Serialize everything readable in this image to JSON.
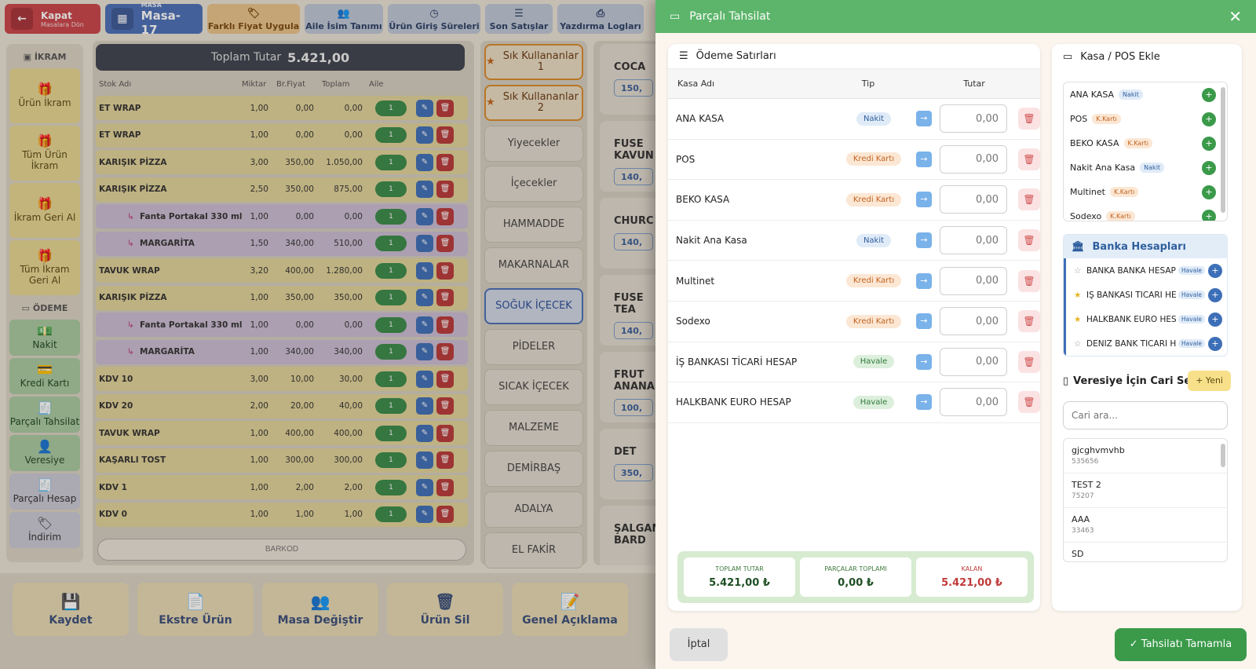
{
  "topbar": {
    "kapat": {
      "label": "Kapat",
      "sub": "Masalara Dön"
    },
    "masa": {
      "label": "MASA",
      "value": "Masa-17"
    },
    "buttons": [
      "Farklı Fiyat Uygula",
      "Aile İsim Tanımı",
      "Ürün Giriş Süreleri",
      "Son Satışlar",
      "Yazdırma Logları"
    ]
  },
  "left": {
    "ikram_header": "İKRAM",
    "ikram_items": [
      "Ürün İkram",
      "Tüm Ürün İkram",
      "İkram Geri Al",
      "Tüm İkram Geri Al"
    ],
    "odeme_header": "ÖDEME",
    "odeme_items": [
      "Nakit",
      "Kredi Kartı",
      "Parçalı Tahsilat",
      "Veresiye",
      "Parçalı Hesap",
      "İndirim"
    ]
  },
  "cart": {
    "total_label": "Toplam Tutar",
    "total_value": "5.421,00",
    "headers": [
      "Stok Adı",
      "Miktar",
      "Br.Fiyat",
      "Toplam",
      "Aile"
    ],
    "rows": [
      {
        "name": "ET WRAP",
        "qty": "1,00",
        "price": "0,00",
        "total": "0,00",
        "aile": "1",
        "sub": false
      },
      {
        "name": "ET WRAP",
        "qty": "1,00",
        "price": "0,00",
        "total": "0,00",
        "aile": "1",
        "sub": false
      },
      {
        "name": "KARIŞIK PİZZA",
        "qty": "3,00",
        "price": "350,00",
        "total": "1.050,00",
        "aile": "1",
        "sub": false
      },
      {
        "name": "KARIŞIK PİZZA",
        "qty": "2,50",
        "price": "350,00",
        "total": "875,00",
        "aile": "1",
        "sub": false
      },
      {
        "name": "Fanta Portakal 330 ml",
        "qty": "1,00",
        "price": "0,00",
        "total": "0,00",
        "aile": "1",
        "sub": true
      },
      {
        "name": "MARGARİTA",
        "qty": "1,50",
        "price": "340,00",
        "total": "510,00",
        "aile": "1",
        "sub": true
      },
      {
        "name": "TAVUK WRAP",
        "qty": "3,20",
        "price": "400,00",
        "total": "1.280,00",
        "aile": "1",
        "sub": false
      },
      {
        "name": "KARIŞIK PİZZA",
        "qty": "1,00",
        "price": "350,00",
        "total": "350,00",
        "aile": "1",
        "sub": false
      },
      {
        "name": "Fanta Portakal 330 ml",
        "qty": "1,00",
        "price": "0,00",
        "total": "0,00",
        "aile": "1",
        "sub": true
      },
      {
        "name": "MARGARİTA",
        "qty": "1,00",
        "price": "340,00",
        "total": "340,00",
        "aile": "1",
        "sub": true
      },
      {
        "name": "KDV 10",
        "qty": "3,00",
        "price": "10,00",
        "total": "30,00",
        "aile": "1",
        "sub": false
      },
      {
        "name": "KDV 20",
        "qty": "2,00",
        "price": "20,00",
        "total": "40,00",
        "aile": "1",
        "sub": false
      },
      {
        "name": "TAVUK WRAP",
        "qty": "1,00",
        "price": "400,00",
        "total": "400,00",
        "aile": "1",
        "sub": false
      },
      {
        "name": "KAŞARLI TOST",
        "qty": "1,00",
        "price": "300,00",
        "total": "300,00",
        "aile": "1",
        "sub": false
      },
      {
        "name": "KDV 1",
        "qty": "1,00",
        "price": "2,00",
        "total": "2,00",
        "aile": "1",
        "sub": false
      },
      {
        "name": "KDV 0",
        "qty": "1,00",
        "price": "1,00",
        "total": "1,00",
        "aile": "1",
        "sub": false
      }
    ],
    "barkod_placeholder": "BARKOD"
  },
  "categories": [
    {
      "label": "Sık Kullananlar 1",
      "kind": "fav"
    },
    {
      "label": "Sık Kullananlar 2",
      "kind": "fav"
    },
    {
      "label": "Yiyecekler",
      "kind": ""
    },
    {
      "label": "İçecekler",
      "kind": ""
    },
    {
      "label": "HAMMADDE",
      "kind": ""
    },
    {
      "label": "MAKARNALAR",
      "kind": ""
    },
    {
      "label": "SOĞUK İÇECEK",
      "kind": "sel"
    },
    {
      "label": "PİDELER",
      "kind": ""
    },
    {
      "label": "SICAK İÇECEK",
      "kind": ""
    },
    {
      "label": "MALZEME",
      "kind": ""
    },
    {
      "label": "DEMİRBAŞ",
      "kind": ""
    },
    {
      "label": "ADALYA",
      "kind": ""
    },
    {
      "label": "EL FAKİR",
      "kind": ""
    }
  ],
  "products": [
    {
      "name": "COCA",
      "price": "150,"
    },
    {
      "name": "FUSE KAVUN",
      "price": "140,"
    },
    {
      "name": "CHURC",
      "price": "140,"
    },
    {
      "name": "FUSE TEA",
      "price": "140,"
    },
    {
      "name": "FRUT ANANAS",
      "price": "100,"
    },
    {
      "name": "DET",
      "price": "350,"
    },
    {
      "name": "ŞALGAM BARD",
      "price": ""
    }
  ],
  "bottom": [
    "Kaydet",
    "Ekstre Ürün",
    "Masa Değiştir",
    "Ürün Sil",
    "Genel Açıklama"
  ],
  "modal": {
    "title": "Parçalı Tahsilat",
    "odeme": {
      "title": "Ödeme Satırları",
      "headers": [
        "Kasa Adı",
        "Tip",
        "Tutar"
      ],
      "rows": [
        {
          "name": "ANA KASA",
          "type": "Nakit",
          "kind": "nakit",
          "amount_placeholder": "0,00"
        },
        {
          "name": "POS",
          "type": "Kredi Kartı",
          "kind": "kredi",
          "amount_placeholder": "0,00"
        },
        {
          "name": "BEKO KASA",
          "type": "Kredi Kartı",
          "kind": "kredi",
          "amount_placeholder": "0,00"
        },
        {
          "name": "Nakit Ana Kasa",
          "type": "Nakit",
          "kind": "nakit",
          "amount_placeholder": "0,00"
        },
        {
          "name": "Multinet",
          "type": "Kredi Kartı",
          "kind": "kredi",
          "amount_placeholder": "0,00"
        },
        {
          "name": "Sodexo",
          "type": "Kredi Kartı",
          "kind": "kredi",
          "amount_placeholder": "0,00"
        },
        {
          "name": "İŞ BANKASI TİCARİ HESAP",
          "type": "Havale",
          "kind": "havale",
          "amount_placeholder": "0,00"
        },
        {
          "name": "HALKBANK EURO HESAP",
          "type": "Havale",
          "kind": "havale",
          "amount_placeholder": "0,00"
        }
      ]
    },
    "summary": {
      "toplam_label": "TOPLAM TUTAR",
      "toplam_value": "5.421,00 ₺",
      "parcalar_label": "PARÇALAR TOPLAMI",
      "parcalar_value": "0,00 ₺",
      "kalan_label": "KALAN",
      "kalan_value": "5.421,00 ₺"
    },
    "kasa_pos": {
      "title": "Kasa / POS Ekle",
      "items": [
        {
          "name": "ANA KASA",
          "badge": "Nakit",
          "kind": "nakit"
        },
        {
          "name": "POS",
          "badge": "K.Kartı",
          "kind": "kredi"
        },
        {
          "name": "BEKO KASA",
          "badge": "K.Kartı",
          "kind": "kredi"
        },
        {
          "name": "Nakit Ana Kasa",
          "badge": "Nakit",
          "kind": "nakit"
        },
        {
          "name": "Multinet",
          "badge": "K.Kartı",
          "kind": "kredi"
        },
        {
          "name": "Sodexo",
          "badge": "K.Kartı",
          "kind": "kredi"
        }
      ]
    },
    "banka": {
      "title": "Banka Hesapları",
      "items": [
        {
          "name": "BANKA BANKA HESAP",
          "badge": "Havale",
          "starred": false
        },
        {
          "name": "İŞ BANKASI TİCARİ HESAP",
          "badge": "Havale",
          "starred": true
        },
        {
          "name": "HALKBANK EURO HESAP",
          "badge": "Havale",
          "starred": true
        },
        {
          "name": "DENİZ BANK TİCARİ HESAP",
          "badge": "Havale",
          "starred": false
        }
      ]
    },
    "veresiye": {
      "title": "Veresiye İçin Cari Seç",
      "yeni_label": "+ Yeni",
      "search_placeholder": "Cari ara...",
      "items": [
        {
          "name": "gjcghvmvhb",
          "id": "535656"
        },
        {
          "name": "TEST 2",
          "id": "75207"
        },
        {
          "name": "AAA",
          "id": "33463"
        },
        {
          "name": "SD",
          "id": ""
        }
      ]
    },
    "footer": {
      "cancel": "İptal",
      "confirm": "✓ Tahsilatı Tamamla"
    }
  }
}
